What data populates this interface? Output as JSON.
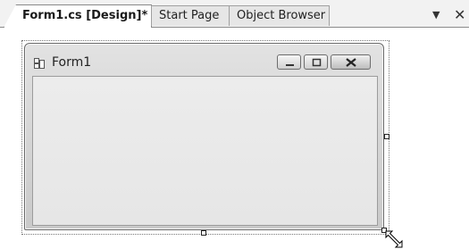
{
  "tabs": [
    {
      "label": "Form1.cs [Design]*",
      "active": true
    },
    {
      "label": "Start Page",
      "active": false
    },
    {
      "label": "Object Browser",
      "active": false
    }
  ],
  "strip_buttons": {
    "menu": "▼",
    "close": "✕"
  },
  "form": {
    "title": "Form1",
    "icon": "form-icon",
    "caption_buttons": [
      "minimize-icon",
      "maximize-icon",
      "close-icon"
    ]
  },
  "cursor": "resize-diagonal-cursor"
}
